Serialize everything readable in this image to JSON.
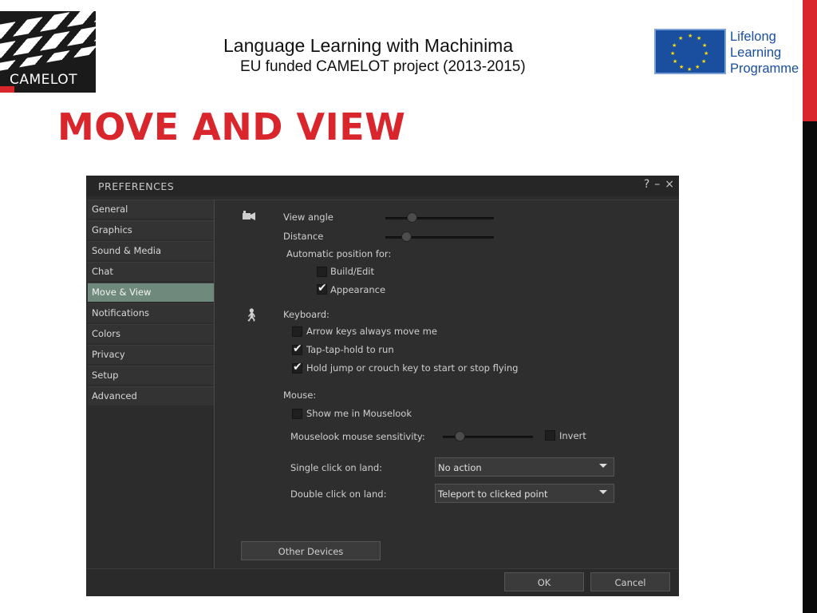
{
  "slide": {
    "logo_text": "CAMELOT",
    "header_title": "Language Learning with Machinima",
    "header_subtitle": "EU funded CAMELOT project (2013-2015)",
    "llp_lines": [
      "Lifelong",
      "Learning",
      "Programme"
    ],
    "title": "MOVE AND VIEW",
    "accent_color": "#d9262c",
    "eu_blue": "#1a4fa0"
  },
  "window": {
    "title": "PREFERENCES",
    "controls": {
      "help": "?",
      "minimize": "–",
      "close": "×"
    },
    "sidebar": {
      "items": [
        {
          "label": "General"
        },
        {
          "label": "Graphics"
        },
        {
          "label": "Sound & Media"
        },
        {
          "label": "Chat"
        },
        {
          "label": "Move & View",
          "active": true
        },
        {
          "label": "Notifications"
        },
        {
          "label": "Colors"
        },
        {
          "label": "Privacy"
        },
        {
          "label": "Setup"
        },
        {
          "label": "Advanced"
        }
      ]
    },
    "view": {
      "view_angle_label": "View angle",
      "distance_label": "Distance",
      "auto_position_label": "Automatic position for:",
      "build_edit_label": "Build/Edit",
      "build_edit_checked": false,
      "appearance_label": "Appearance",
      "appearance_checked": true
    },
    "keyboard": {
      "heading": "Keyboard:",
      "arrow_keys_label": "Arrow keys always move me",
      "arrow_keys_checked": false,
      "tap_hold_label": "Tap-tap-hold to run",
      "tap_hold_checked": true,
      "hold_jump_label": "Hold jump or crouch key to start or stop flying",
      "hold_jump_checked": true
    },
    "mouse": {
      "heading": "Mouse:",
      "show_mouselook_label": "Show me in Mouselook",
      "show_mouselook_checked": false,
      "sensitivity_label": "Mouselook mouse sensitivity:",
      "invert_label": "Invert",
      "invert_checked": false,
      "single_click_label": "Single click on land:",
      "single_click_value": "No action",
      "double_click_label": "Double click on land:",
      "double_click_value": "Teleport to clicked point"
    },
    "other_devices_label": "Other Devices",
    "ok_label": "OK",
    "cancel_label": "Cancel"
  }
}
